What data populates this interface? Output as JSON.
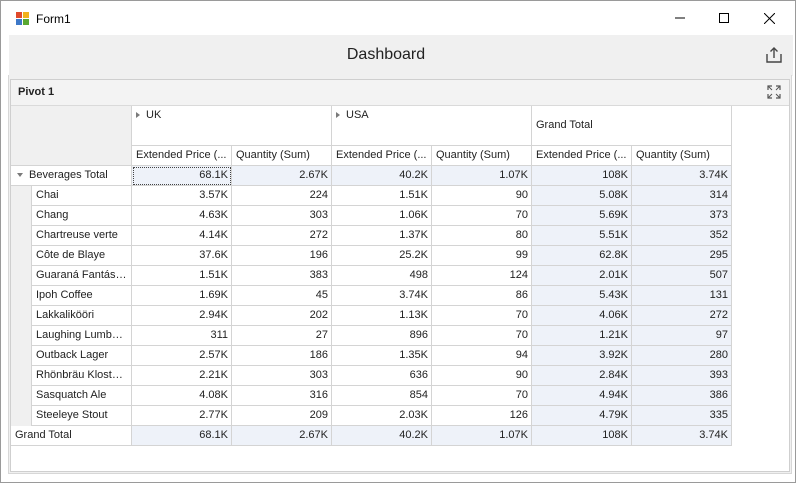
{
  "window": {
    "title": "Form1"
  },
  "dashboard": {
    "title": "Dashboard"
  },
  "pivot": {
    "title": "Pivot 1",
    "column_groups": [
      "UK",
      "USA",
      "Grand Total"
    ],
    "measure_headers": [
      "Extended Price (...",
      "Quantity (Sum)",
      "Extended Price (...",
      "Quantity (Sum)",
      "Extended Price (...",
      "Quantity (Sum)"
    ],
    "category_row": {
      "label": "Beverages Total",
      "values": [
        "68.1K",
        "2.67K",
        "40.2K",
        "1.07K",
        "108K",
        "3.74K"
      ]
    },
    "rows": [
      {
        "label": "Chai",
        "values": [
          "3.57K",
          "224",
          "1.51K",
          "90",
          "5.08K",
          "314"
        ]
      },
      {
        "label": "Chang",
        "values": [
          "4.63K",
          "303",
          "1.06K",
          "70",
          "5.69K",
          "373"
        ]
      },
      {
        "label": "Chartreuse verte",
        "values": [
          "4.14K",
          "272",
          "1.37K",
          "80",
          "5.51K",
          "352"
        ]
      },
      {
        "label": "Côte de Blaye",
        "values": [
          "37.6K",
          "196",
          "25.2K",
          "99",
          "62.8K",
          "295"
        ]
      },
      {
        "label": "Guaraná Fantásti...",
        "values": [
          "1.51K",
          "383",
          "498",
          "124",
          "2.01K",
          "507"
        ]
      },
      {
        "label": "Ipoh Coffee",
        "values": [
          "1.69K",
          "45",
          "3.74K",
          "86",
          "5.43K",
          "131"
        ]
      },
      {
        "label": "Lakkalikööri",
        "values": [
          "2.94K",
          "202",
          "1.13K",
          "70",
          "4.06K",
          "272"
        ]
      },
      {
        "label": "Laughing Lumber...",
        "values": [
          "311",
          "27",
          "896",
          "70",
          "1.21K",
          "97"
        ]
      },
      {
        "label": "Outback Lager",
        "values": [
          "2.57K",
          "186",
          "1.35K",
          "94",
          "3.92K",
          "280"
        ]
      },
      {
        "label": "Rhönbräu Kloster...",
        "values": [
          "2.21K",
          "303",
          "636",
          "90",
          "2.84K",
          "393"
        ]
      },
      {
        "label": "Sasquatch Ale",
        "values": [
          "4.08K",
          "316",
          "854",
          "70",
          "4.94K",
          "386"
        ]
      },
      {
        "label": "Steeleye Stout",
        "values": [
          "2.77K",
          "209",
          "2.03K",
          "126",
          "4.79K",
          "335"
        ]
      }
    ],
    "grand_total_row": {
      "label": "Grand Total",
      "values": [
        "68.1K",
        "2.67K",
        "40.2K",
        "1.07K",
        "108K",
        "3.74K"
      ]
    }
  },
  "icons": {
    "app": "app-icon",
    "minimize": "minimize-icon",
    "maximize": "maximize-window-icon",
    "close": "close-icon",
    "export": "export-icon",
    "pivot_maximize": "maximize-icon"
  }
}
